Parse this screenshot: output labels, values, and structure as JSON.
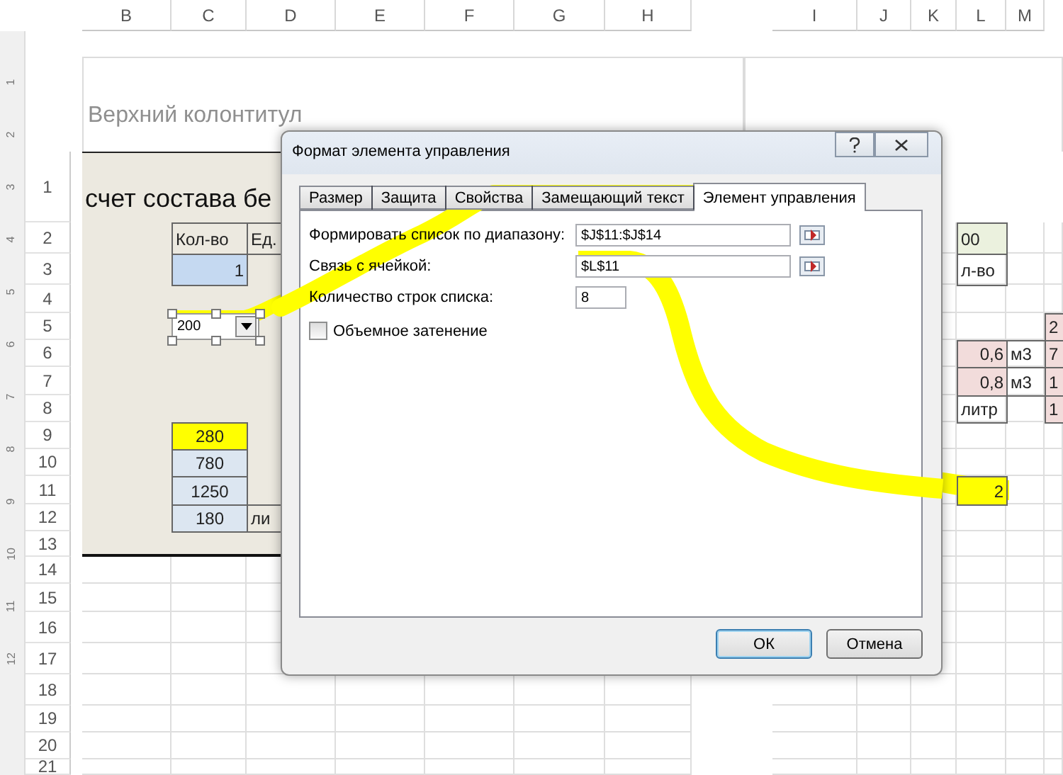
{
  "sheet": {
    "left_columns": [
      "B",
      "C",
      "D",
      "E",
      "F",
      "G",
      "H"
    ],
    "right_columns": [
      "I",
      "J",
      "K",
      "L",
      "M"
    ],
    "ruler_marks": [
      "1",
      "2",
      "3",
      "4",
      "5",
      "6",
      "7",
      "8",
      "9",
      "10",
      "11",
      "12"
    ],
    "page_header": "Верхний колонтитул",
    "title": "счет состава бе",
    "rows": [
      {
        "number": "1"
      },
      {
        "number": "2",
        "cells": [
          {
            "kind": "blank"
          },
          {
            "kind": "text",
            "text": "Кол-во"
          },
          {
            "kind": "text",
            "text": "Ед."
          },
          {
            "kind": "blank"
          },
          {
            "kind": "blank"
          },
          {
            "kind": "blank"
          },
          {
            "kind": "blank"
          },
          {
            "kind": "blank"
          },
          {
            "kind": "blank"
          },
          {
            "kind": "blank"
          },
          {
            "kind": "text",
            "text": "00",
            "color": "#ebf1de"
          }
        ]
      },
      {
        "number": "3",
        "cells": [
          {
            "kind": "blank"
          },
          {
            "kind": "number",
            "text": "1",
            "color": "#c5d9f1"
          },
          {
            "kind": "blank"
          },
          {
            "kind": "blank"
          },
          {
            "kind": "blank"
          },
          {
            "kind": "blank"
          },
          {
            "kind": "blank"
          },
          {
            "kind": "blank"
          },
          {
            "kind": "blank"
          },
          {
            "kind": "blank"
          },
          {
            "kind": "text",
            "text": "л-во"
          }
        ]
      },
      {
        "number": "4"
      },
      {
        "number": "5",
        "cells": [
          {
            "kind": "blank"
          },
          {
            "kind": "blank"
          },
          {
            "kind": "blank"
          },
          {
            "kind": "blank"
          },
          {
            "kind": "blank"
          },
          {
            "kind": "blank"
          },
          {
            "kind": "blank"
          },
          {
            "kind": "blank"
          },
          {
            "kind": "blank"
          },
          {
            "kind": "blank"
          },
          {
            "kind": "blank"
          },
          {
            "kind": "blank"
          },
          {
            "kind": "text",
            "text": "2",
            "color": "#f2dcdb"
          }
        ]
      },
      {
        "number": "6",
        "cells": [
          {
            "kind": "blank"
          },
          {
            "kind": "blank"
          },
          {
            "kind": "blank"
          },
          {
            "kind": "blank"
          },
          {
            "kind": "blank"
          },
          {
            "kind": "blank"
          },
          {
            "kind": "blank"
          },
          {
            "kind": "blank"
          },
          {
            "kind": "blank"
          },
          {
            "kind": "blank"
          },
          {
            "kind": "number",
            "text": "0,6",
            "color": "#f2dcdb"
          },
          {
            "kind": "text",
            "text": "м3"
          },
          {
            "kind": "text",
            "text": "7",
            "color": "#f2dcdb"
          }
        ]
      },
      {
        "number": "7",
        "cells": [
          {
            "kind": "blank"
          },
          {
            "kind": "blank"
          },
          {
            "kind": "blank"
          },
          {
            "kind": "blank"
          },
          {
            "kind": "blank"
          },
          {
            "kind": "blank"
          },
          {
            "kind": "blank"
          },
          {
            "kind": "blank"
          },
          {
            "kind": "blank"
          },
          {
            "kind": "blank"
          },
          {
            "kind": "number",
            "text": "0,8",
            "color": "#f2dcdb"
          },
          {
            "kind": "text",
            "text": "м3"
          },
          {
            "kind": "text",
            "text": "1",
            "color": "#f2dcdb"
          }
        ]
      },
      {
        "number": "8",
        "cells": [
          {
            "kind": "blank"
          },
          {
            "kind": "blank"
          },
          {
            "kind": "blank"
          },
          {
            "kind": "blank"
          },
          {
            "kind": "blank"
          },
          {
            "kind": "blank"
          },
          {
            "kind": "blank"
          },
          {
            "kind": "blank"
          },
          {
            "kind": "blank"
          },
          {
            "kind": "blank"
          },
          {
            "kind": "text",
            "text": "литр"
          },
          {
            "kind": "blank"
          },
          {
            "kind": "text",
            "text": "1",
            "color": "#f2dcdb"
          }
        ]
      },
      {
        "number": "9",
        "cells": [
          {
            "kind": "blank"
          },
          {
            "kind": "centered",
            "text": "280",
            "color": "#ffff00"
          }
        ]
      },
      {
        "number": "10",
        "cells": [
          {
            "kind": "blank"
          },
          {
            "kind": "centered",
            "text": "780",
            "color": "#dce6f1"
          }
        ]
      },
      {
        "number": "11",
        "cells": [
          {
            "kind": "blank"
          },
          {
            "kind": "centered",
            "text": "1250",
            "color": "#dce6f1"
          },
          {
            "kind": "blank"
          },
          {
            "kind": "blank"
          },
          {
            "kind": "blank"
          },
          {
            "kind": "blank"
          },
          {
            "kind": "blank"
          },
          {
            "kind": "blank"
          },
          {
            "kind": "blank"
          },
          {
            "kind": "blank"
          },
          {
            "kind": "number",
            "text": "2",
            "color": "#ffff00"
          }
        ]
      },
      {
        "number": "12",
        "cells": [
          {
            "kind": "blank"
          },
          {
            "kind": "centered",
            "text": "180",
            "color": "#dce6f1"
          },
          {
            "kind": "text",
            "text": "ли"
          }
        ]
      },
      {
        "number": "13"
      },
      {
        "number": "14"
      },
      {
        "number": "15"
      },
      {
        "number": "16"
      },
      {
        "number": "17"
      },
      {
        "number": "18"
      },
      {
        "number": "19"
      },
      {
        "number": "20"
      },
      {
        "number": "21"
      }
    ],
    "combo_box": {
      "value": "200",
      "selected": true
    }
  },
  "dialog": {
    "title": "Формат элемента управления",
    "tabs": [
      {
        "label": "Размер",
        "selected": false
      },
      {
        "label": "Защита",
        "selected": false
      },
      {
        "label": "Свойства",
        "selected": false
      },
      {
        "label": "Замещающий текст",
        "selected": false
      },
      {
        "label": "Элемент управления",
        "selected": true
      }
    ],
    "fields": [
      {
        "label": "Формировать список по диапазону:",
        "value": "$J$11:$J$14",
        "kind": "range"
      },
      {
        "label": "Связь с ячейкой:",
        "value": "$L$11",
        "kind": "range"
      },
      {
        "label": "Количество строк списка:",
        "value": "8",
        "kind": "number"
      }
    ],
    "checkbox": {
      "label": "Объемное затенение",
      "checked": false
    },
    "buttons": [
      {
        "label": "ОК",
        "default": true
      },
      {
        "label": "Отмена",
        "default": false
      }
    ]
  }
}
